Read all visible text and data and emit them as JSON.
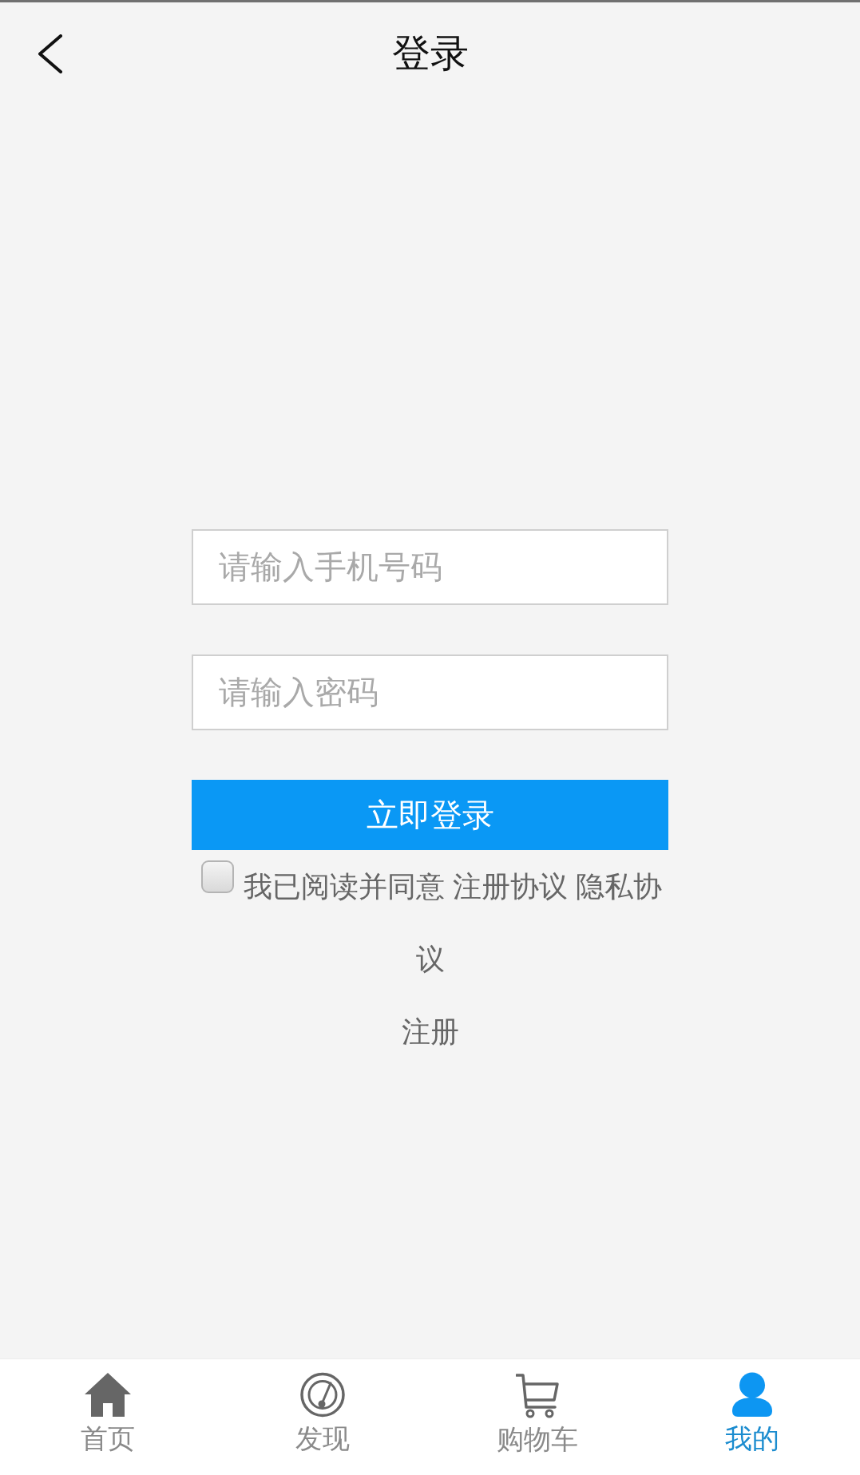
{
  "header": {
    "title": "登录"
  },
  "form": {
    "fields": [
      {
        "placeholder": "请输入手机号码"
      },
      {
        "placeholder": "请输入密码"
      }
    ],
    "submit_button": "立即登录",
    "agreement": {
      "checked": false,
      "text": "我已阅读并同意 注册协议 隐私协议"
    },
    "register_link": "注册"
  },
  "tab_bar": {
    "items": [
      {
        "label": "首页",
        "selected": false
      },
      {
        "label": "发现",
        "selected": false
      },
      {
        "label": "购物车",
        "selected": false
      },
      {
        "label": "我的",
        "selected": true
      }
    ]
  }
}
